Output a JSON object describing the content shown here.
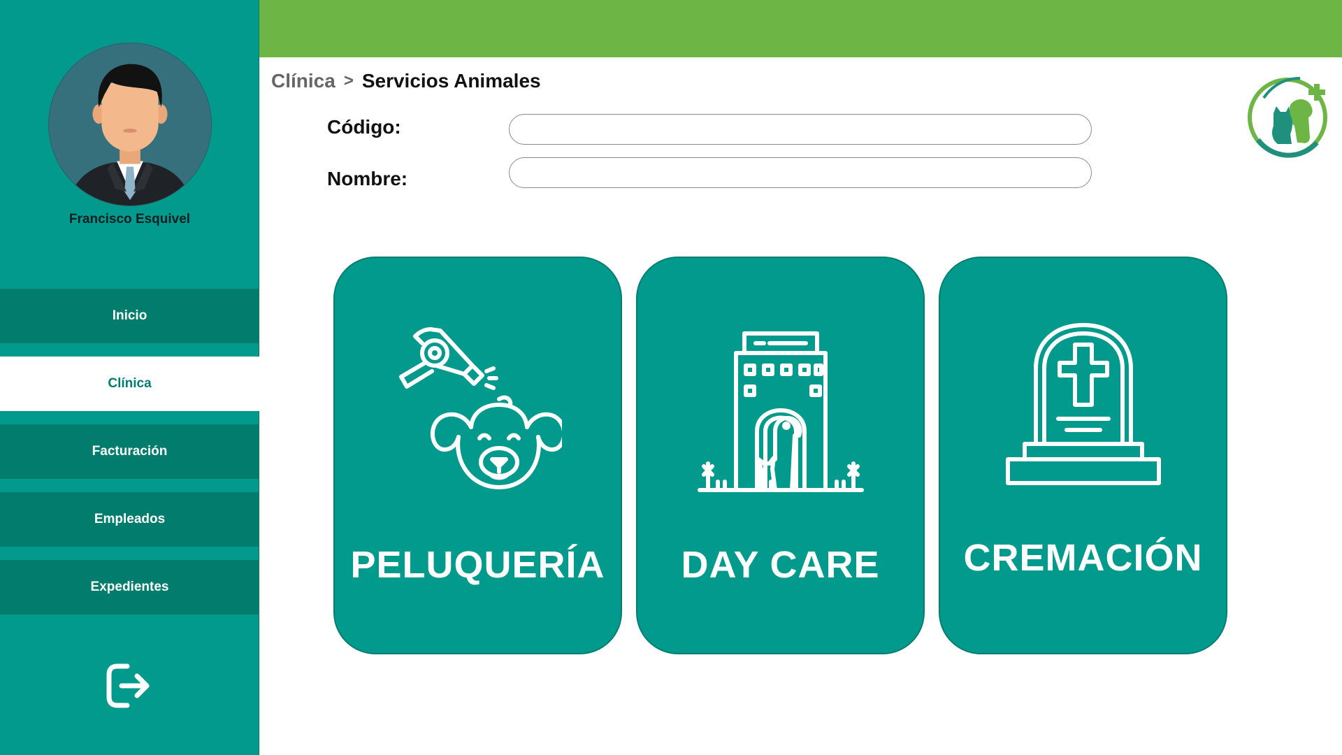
{
  "sidebar": {
    "user_name": "Francisco Esquivel",
    "items": [
      {
        "label": "Inicio"
      },
      {
        "label": "Clínica"
      },
      {
        "label": "Facturación"
      },
      {
        "label": "Empleados"
      },
      {
        "label": "Expedientes"
      }
    ],
    "active_item": "Clínica",
    "logout_icon": "logout-icon"
  },
  "breadcrumb": {
    "parent": "Clínica",
    "separator": ">",
    "current": "Servicios Animales"
  },
  "form": {
    "code_label": "Código:",
    "code_value": "",
    "name_label": "Nombre:",
    "name_value": ""
  },
  "services": [
    {
      "title": "PELUQUERÍA",
      "icon": "dog-grooming-icon"
    },
    {
      "title": "DAY CARE",
      "icon": "pet-daycare-icon"
    },
    {
      "title": "CREMACIÓN",
      "icon": "tombstone-icon"
    }
  ],
  "colors": {
    "sidebar": "#019a8c",
    "nav_item": "#017c6d",
    "topbar": "#6db646",
    "card": "#029a8c"
  }
}
